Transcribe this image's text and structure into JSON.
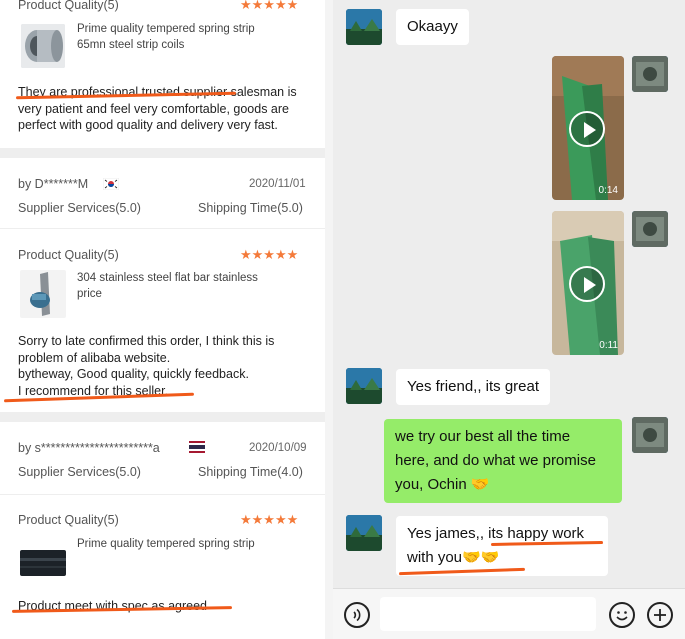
{
  "reviews": {
    "first": {
      "quality_label": "Product Quality(5)",
      "stars": "★★★★★",
      "product": [
        "Prime quality tempered spring strip",
        "65mn steel strip coils"
      ],
      "review_lines": [
        "They are professional trusted supplier salesman is",
        "very patient and feel very comfortable, goods are",
        "perfect with good quality and delivery very fast."
      ]
    },
    "second": {
      "buyer": "by D*******M",
      "date": "2020/11/01",
      "supplier_services": "Supplier Services(5.0)",
      "shipping_time": "Shipping Time(5.0)",
      "quality_label": "Product Quality(5)",
      "stars": "★★★★★",
      "product": [
        "304 stainless steel flat bar stainless",
        "price"
      ],
      "review_lines": [
        "Sorry to late confirmed this order, I think this is",
        "problem of alibaba website.",
        "bytheway, Good quality, quickly feedback.",
        "I recommend for this seller."
      ]
    },
    "third": {
      "buyer": "by s***********************a",
      "date": "2020/10/09",
      "supplier_services": "Supplier Services(5.0)",
      "shipping_time": "Shipping Time(4.0)",
      "quality_label": "Product Quality(5)",
      "stars": "★★★★★",
      "product": [
        "Prime quality tempered spring strip"
      ],
      "review_lines": [
        "Product meet with spec as agreed"
      ]
    }
  },
  "chat": {
    "messages": [
      {
        "side": "left",
        "type": "text",
        "lines": [
          "Okaayy"
        ]
      },
      {
        "side": "right",
        "type": "video",
        "duration": "0:14"
      },
      {
        "side": "right",
        "type": "video",
        "duration": "0:11"
      },
      {
        "side": "left",
        "type": "text",
        "lines": [
          "Yes friend,, its great"
        ]
      },
      {
        "side": "right",
        "type": "text",
        "lines": [
          "we try our best all the time",
          "here, and do what we promise",
          "you, Ochin 🤝"
        ]
      },
      {
        "side": "left",
        "type": "text",
        "lines": [
          "Yes james,, its happy work",
          "with you🤝🤝"
        ]
      }
    ],
    "input": {
      "voice_icon": "voice-icon",
      "emoji_icon": "emoji-icon",
      "plus_icon": "plus-icon"
    }
  },
  "colors": {
    "accent_orange": "#f05a1a",
    "star_orange": "#f47a3a",
    "chat_green": "#95ec69",
    "chat_bg": "#ededed"
  }
}
